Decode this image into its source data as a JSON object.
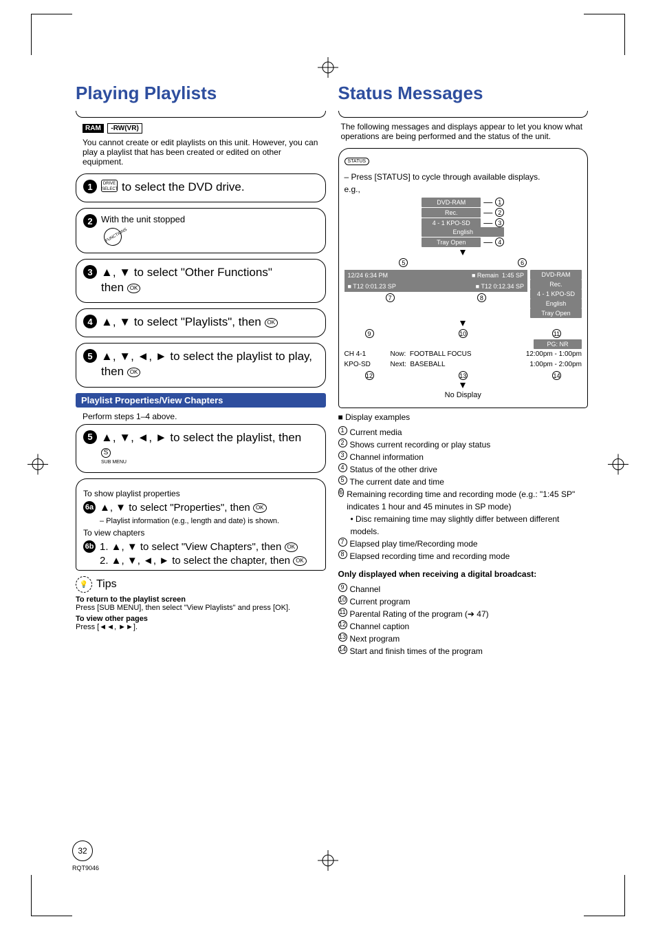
{
  "page": {
    "number": "32",
    "docid": "RQT9046"
  },
  "left": {
    "title": "Playing Playlists",
    "badges": {
      "ram": "RAM",
      "rwvr": "-RW(VR)"
    },
    "intro": "You cannot create or edit playlists on this unit. However, you can play a playlist that has been created or edited on other equipment.",
    "step1": "to select the DVD drive.",
    "step2": "With the unit stopped",
    "step3a": "▲, ▼ to select \"Other Functions\"",
    "step3b": "then",
    "step4": "▲, ▼ to select \"Playlists\", then",
    "step5a": "▲, ▼, ◄, ► to select the playlist to play, then",
    "subhead": "Playlist Properties/View Chapters",
    "perform": "Perform steps 1–4 above.",
    "step5b": "▲, ▼, ◄, ► to select the playlist, then",
    "submenu": "SUB MENU",
    "propsHead": "To show playlist properties",
    "step6a": "▲, ▼ to select \"Properties\", then",
    "propsNote": "– Playlist information (e.g., length and date) is shown.",
    "chaptersHead": "To view chapters",
    "step6b1": "1. ▲, ▼ to select \"View Chapters\", then",
    "step6b2": "2. ▲, ▼, ◄, ► to select the chapter, then",
    "tipsLabel": "Tips",
    "tip1h": "To return to the playlist screen",
    "tip1b": "Press [SUB MENU], then select \"View Playlists\" and press [OK].",
    "tip2h": "To view other pages",
    "tip2b": "Press [◄◄, ►►].",
    "ok": "OK",
    "s": "S",
    "driveSelect": "DRIVE SELECT",
    "functions": "FUNCTIONS"
  },
  "right": {
    "title": "Status Messages",
    "intro": "The following messages and displays appear to let you know what operations are being performed and the status of the unit.",
    "statusBtn": "STATUS",
    "pressStatus": "– Press [STATUS] to cycle through available displays.",
    "eg": "e.g.,",
    "box1": {
      "a": "DVD-RAM",
      "b": "Rec.",
      "c": "4 - 1 KPO-SD",
      "d": "English",
      "e": "Tray Open"
    },
    "row1": {
      "datetime": "12/24  6:34 PM",
      "remain": "■ Remain",
      "remainVal": "1:45  SP",
      "t12a": "■ T12   0:01.23  SP",
      "t12b": "■ T12    0:12.34  SP"
    },
    "box2": {
      "a": "DVD-RAM",
      "b": "Rec.",
      "c": "4 - 1 KPO-SD",
      "d": "English",
      "e": "Tray Open"
    },
    "prog": {
      "ch": "CH 4-1",
      "kpo": "KPO-SD",
      "nowL": "Now:",
      "nowV": "FOOTBALL FOCUS",
      "nextL": "Next:",
      "nextV": "BASEBALL",
      "pg": "PG: NR",
      "t1": "12:00pm - 1:00pm",
      "t2": "1:00pm - 2:00pm"
    },
    "noDisplay": "No Display",
    "deHead": "■ Display examples",
    "de": {
      "1": "Current media",
      "2": "Shows current recording or play status",
      "3": "Channel information",
      "4": "Status of the other drive",
      "5": "The current date and time",
      "6": "Remaining recording time and recording mode (e.g.: \"1:45 SP\" indicates 1 hour and 45 minutes in SP mode)",
      "6b": "• Disc remaining time may slightly differ between different models.",
      "7": "Elapsed play time/Recording mode",
      "8": "Elapsed recording time and recording mode"
    },
    "digitalHead": "Only displayed when receiving a digital broadcast:",
    "dd": {
      "9": "Channel",
      "10": "Current program",
      "11": "Parental Rating of the program (➔ 47)",
      "12": "Channel caption",
      "13": "Next program",
      "14": "Start and finish times of the program"
    }
  }
}
